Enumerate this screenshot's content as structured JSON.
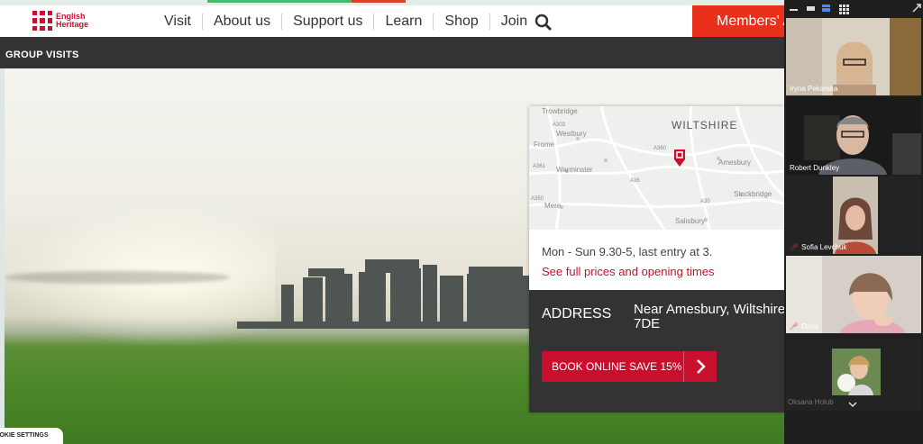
{
  "site": {
    "logo_line1": "English",
    "logo_line2": "Heritage",
    "nav": [
      "Visit",
      "About us",
      "Support us",
      "Learn",
      "Shop",
      "Join"
    ],
    "members_label": "Members' A",
    "subnav_label": "GROUP VISITS"
  },
  "map": {
    "county": "WILTSHIRE",
    "places": [
      "Trowbridge",
      "Westbury",
      "Frome",
      "Warminster",
      "Amesbury",
      "Stockbridge",
      "Mere",
      "Salisbury",
      "A303",
      "A36",
      "A360",
      "A350",
      "A361",
      "A30"
    ]
  },
  "info": {
    "hours": "Mon - Sun 9.30-5, last entry at 3.",
    "prices_link": "See full prices and opening times",
    "address_label": "ADDRESS",
    "address_line1": "Near Amesbury, Wiltshire",
    "address_line2": "7DE",
    "book_label": "BOOK ONLINE SAVE 15%"
  },
  "cookie_label": "OOKIE SETTINGS",
  "zoom": {
    "participants": [
      {
        "name": "Iryna Pekarska",
        "muted": false,
        "active": false
      },
      {
        "name": "Robert Dunkley",
        "muted": false,
        "active": true
      },
      {
        "name": "Sofia Levchuk",
        "muted": true,
        "active": false
      },
      {
        "name": "Daria",
        "muted": true,
        "active": false
      }
    ],
    "footer_name": "Oksana Holub"
  },
  "colors": {
    "brand_red": "#c8102e",
    "members_red": "#e8301c",
    "dark": "#333333",
    "active_green": "#2ec866"
  }
}
